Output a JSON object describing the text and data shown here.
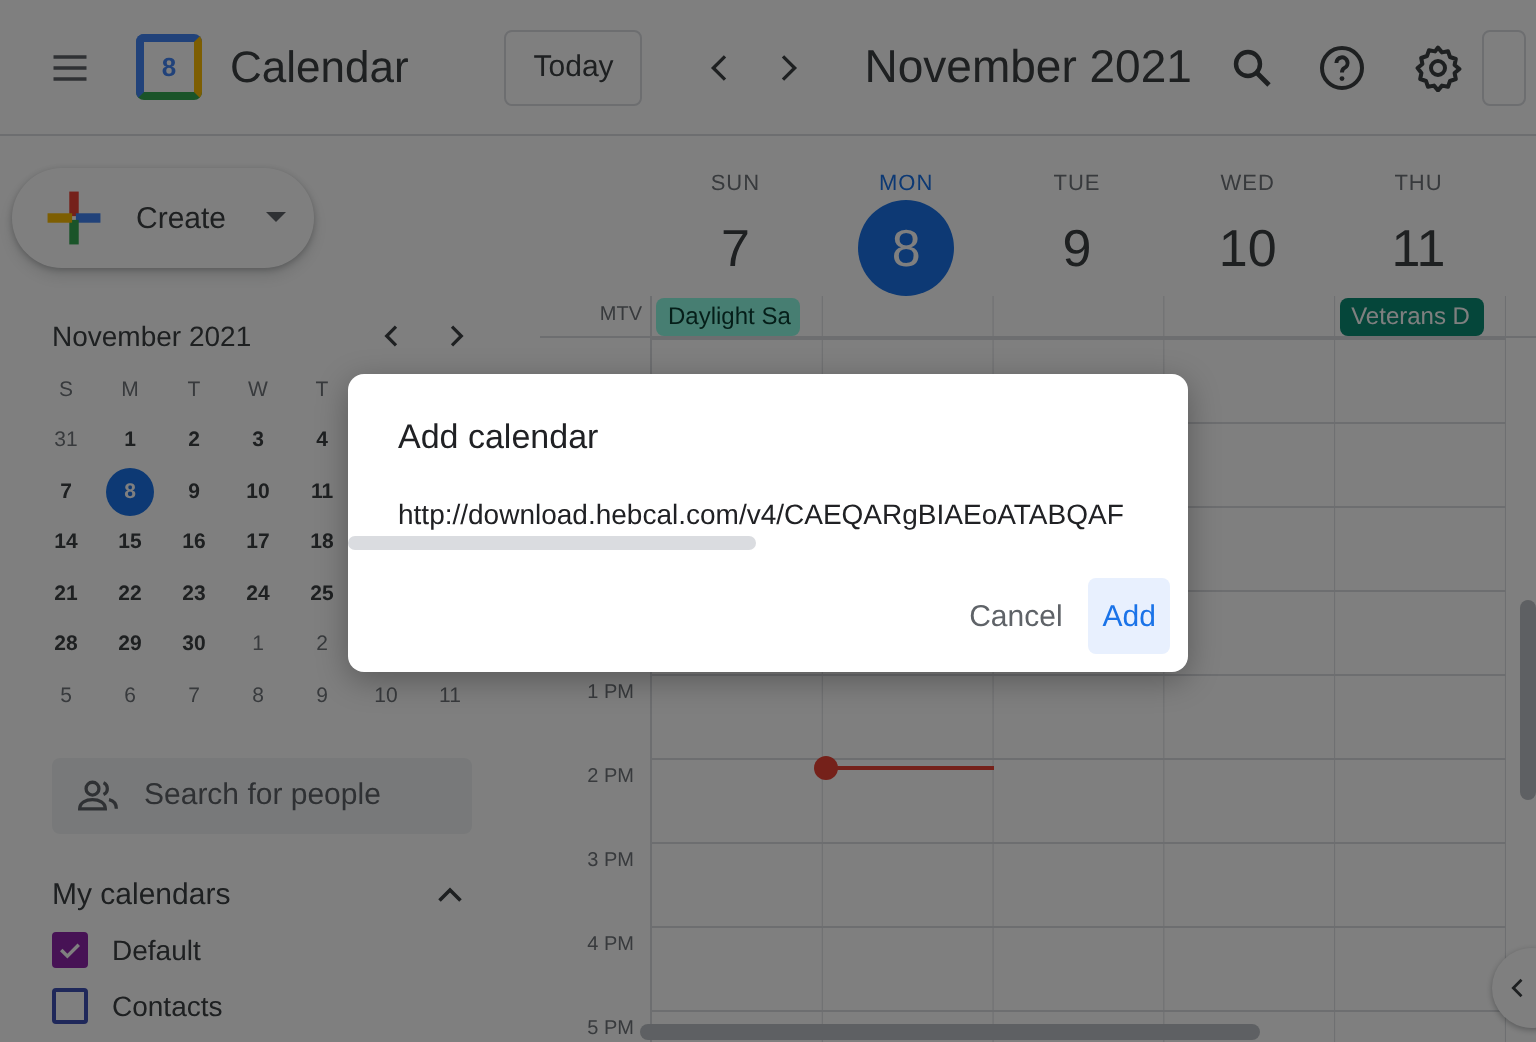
{
  "header": {
    "app_name": "Calendar",
    "logo_day": "8",
    "today_button": "Today",
    "period": "November 2021"
  },
  "create_button": "Create",
  "mini_calendar": {
    "title": "November 2021",
    "weekdays": [
      "S",
      "M",
      "T",
      "W",
      "T"
    ],
    "weeks": [
      [
        {
          "label": "31",
          "muted": true,
          "selected": false
        },
        {
          "label": "1",
          "muted": false,
          "selected": false
        },
        {
          "label": "2",
          "muted": false,
          "selected": false
        },
        {
          "label": "3",
          "muted": false,
          "selected": false
        },
        {
          "label": "4",
          "muted": false,
          "selected": false
        }
      ],
      [
        {
          "label": "7",
          "muted": false,
          "selected": false
        },
        {
          "label": "8",
          "muted": false,
          "selected": true
        },
        {
          "label": "9",
          "muted": false,
          "selected": false
        },
        {
          "label": "10",
          "muted": false,
          "selected": false
        },
        {
          "label": "11",
          "muted": false,
          "selected": false
        }
      ],
      [
        {
          "label": "14",
          "muted": false,
          "selected": false
        },
        {
          "label": "15",
          "muted": false,
          "selected": false
        },
        {
          "label": "16",
          "muted": false,
          "selected": false
        },
        {
          "label": "17",
          "muted": false,
          "selected": false
        },
        {
          "label": "18",
          "muted": false,
          "selected": false
        }
      ],
      [
        {
          "label": "21",
          "muted": false,
          "selected": false
        },
        {
          "label": "22",
          "muted": false,
          "selected": false
        },
        {
          "label": "23",
          "muted": false,
          "selected": false
        },
        {
          "label": "24",
          "muted": false,
          "selected": false
        },
        {
          "label": "25",
          "muted": false,
          "selected": false
        }
      ],
      [
        {
          "label": "28",
          "muted": false,
          "selected": false
        },
        {
          "label": "29",
          "muted": false,
          "selected": false
        },
        {
          "label": "30",
          "muted": false,
          "selected": false
        },
        {
          "label": "1",
          "muted": true,
          "selected": false
        },
        {
          "label": "2",
          "muted": true,
          "selected": false
        }
      ],
      [
        {
          "label": "5",
          "muted": true,
          "selected": false
        },
        {
          "label": "6",
          "muted": true,
          "selected": false
        },
        {
          "label": "7",
          "muted": true,
          "selected": false
        },
        {
          "label": "8",
          "muted": true,
          "selected": false
        },
        {
          "label": "9",
          "muted": true,
          "selected": false
        },
        {
          "label": "10",
          "muted": true,
          "selected": false
        },
        {
          "label": "11",
          "muted": true,
          "selected": false
        }
      ]
    ]
  },
  "search_people": {
    "placeholder": "Search for people"
  },
  "my_calendars": {
    "title": "My calendars",
    "expanded": true,
    "items": [
      {
        "label": "Default",
        "checked": true,
        "color": "#471255"
      },
      {
        "label": "Contacts",
        "checked": false,
        "color": "#1f285a"
      }
    ]
  },
  "days": [
    {
      "weekday": "SUN",
      "date": "7",
      "selected": false,
      "event": {
        "title": "Daylight Sa",
        "past": true,
        "color": "#477e72"
      }
    },
    {
      "weekday": "MON",
      "date": "8",
      "selected": true
    },
    {
      "weekday": "TUE",
      "date": "9",
      "selected": false
    },
    {
      "weekday": "WED",
      "date": "10",
      "selected": false
    },
    {
      "weekday": "THU",
      "date": "11",
      "selected": false,
      "event": {
        "title": "Veterans D",
        "past": false,
        "color": "#05463a"
      }
    }
  ],
  "timezone": "MTV",
  "time_labels": [
    "1 PM",
    "2 PM",
    "3 PM",
    "4 PM",
    "5 PM"
  ],
  "dialog": {
    "title": "Add calendar",
    "url": "http://download.hebcal.com/v4/CAEQARgBIAEoATABQAF",
    "buttons": [
      {
        "label": "Cancel",
        "kind": "text"
      },
      {
        "label": "Add",
        "kind": "primary"
      }
    ]
  }
}
